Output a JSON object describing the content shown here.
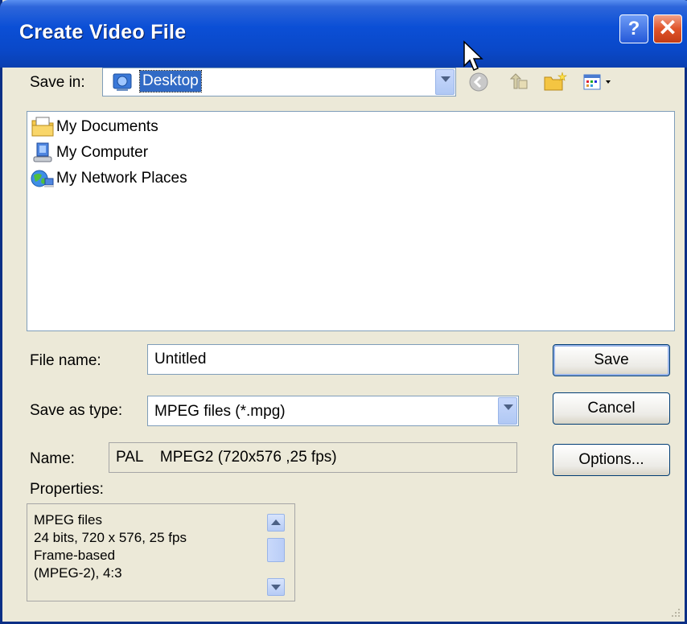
{
  "window": {
    "title": "Create Video File",
    "help_label": "?",
    "close_label": "✕"
  },
  "save_in": {
    "label": "Save in:",
    "value": "Desktop",
    "value_icon": "desktop-icon"
  },
  "toolbar": {
    "icons": [
      "back-icon",
      "up-folder-icon",
      "new-folder-icon",
      "view-menu-icon"
    ]
  },
  "files": [
    {
      "name": "My Documents",
      "icon": "my-documents-icon"
    },
    {
      "name": "My Computer",
      "icon": "my-computer-icon"
    },
    {
      "name": "My Network Places",
      "icon": "my-network-places-icon"
    }
  ],
  "file_name": {
    "label": "File name:",
    "value": "Untitled"
  },
  "save_as_type": {
    "label": "Save as type:",
    "value": "MPEG files (*.mpg)"
  },
  "name": {
    "label": "Name:",
    "value": "PAL    MPEG2 (720x576 ,25 fps)"
  },
  "properties": {
    "label": "Properties:",
    "lines": [
      "MPEG files",
      "24 bits, 720 x 576, 25 fps",
      "Frame-based",
      "(MPEG-2),  4:3"
    ]
  },
  "buttons": {
    "save": "Save",
    "cancel": "Cancel",
    "options": "Options..."
  },
  "colors": {
    "titlebar": "#0a48c8",
    "dialog_bg": "#ece9d8",
    "selection": "#316ac5"
  }
}
